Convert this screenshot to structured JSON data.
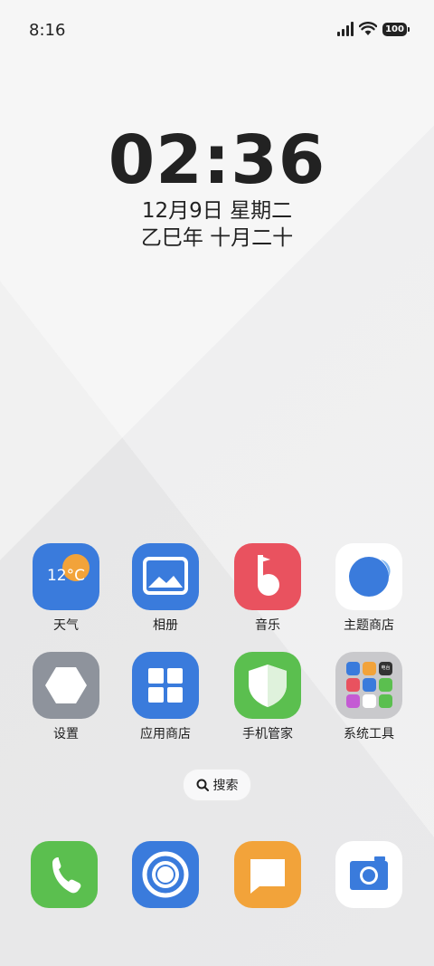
{
  "status_bar": {
    "time": "8:16",
    "battery": "100",
    "icons": [
      "signal-icon",
      "wifi-icon",
      "battery-icon"
    ]
  },
  "clock": {
    "time": "02:36",
    "date": "12月9日 星期二",
    "lunar": "乙巳年 十月二十"
  },
  "apps_row1": [
    {
      "label": "天气",
      "icon": "weather-icon",
      "temp": "12°C",
      "color": "#3a7bdc"
    },
    {
      "label": "相册",
      "icon": "gallery-icon",
      "color": "#3a7bdc"
    },
    {
      "label": "音乐",
      "icon": "music-icon",
      "color": "#e9525f"
    },
    {
      "label": "主题商店",
      "icon": "theme-store-icon",
      "color": "#ffffff"
    }
  ],
  "apps_row2": [
    {
      "label": "设置",
      "icon": "settings-icon",
      "color": "#8e939c"
    },
    {
      "label": "应用商店",
      "icon": "app-store-icon",
      "color": "#3a7bdc"
    },
    {
      "label": "手机管家",
      "icon": "phone-manager-icon",
      "color": "#5bbf4f"
    },
    {
      "label": "系统工具",
      "icon": "system-tools-folder-icon",
      "color": "#c9c9cc",
      "mini_label": "电台"
    }
  ],
  "search": {
    "label": "搜索"
  },
  "dock": [
    {
      "icon": "phone-icon",
      "color": "#5bbf4f"
    },
    {
      "icon": "browser-icon",
      "color": "#3a7bdc"
    },
    {
      "icon": "messages-icon",
      "color": "#f2a33a"
    },
    {
      "icon": "camera-icon",
      "color": "#ffffff"
    }
  ]
}
